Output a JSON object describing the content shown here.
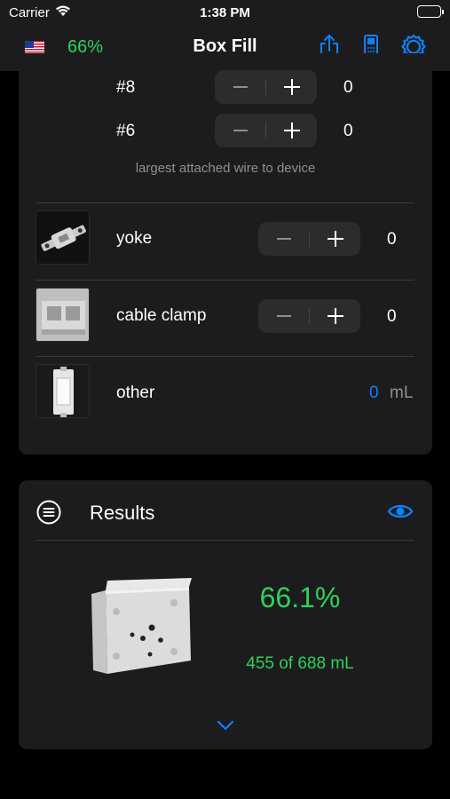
{
  "status_bar": {
    "carrier": "Carrier",
    "time": "1:38 PM"
  },
  "nav": {
    "flag": "us-flag",
    "fill_percent": "66%",
    "title": "Box Fill",
    "icons": [
      "share-icon",
      "device-icon",
      "settings-icon"
    ]
  },
  "wires": [
    {
      "label": "#8",
      "count": "0"
    },
    {
      "label": "#6",
      "count": "0"
    }
  ],
  "wires_hint": "largest attached wire to device",
  "items": [
    {
      "label": "yoke",
      "count": "0"
    },
    {
      "label": "cable clamp",
      "count": "0"
    }
  ],
  "other": {
    "label": "other",
    "value": "0",
    "unit": "mL"
  },
  "results": {
    "title": "Results",
    "percent": "66.1%",
    "volume": "455 of 688 mL"
  },
  "colors": {
    "accent_blue": "#0a84ff",
    "accent_green": "#30d158",
    "card_bg": "#1c1c1e",
    "stepper_bg": "#2c2c2e"
  }
}
